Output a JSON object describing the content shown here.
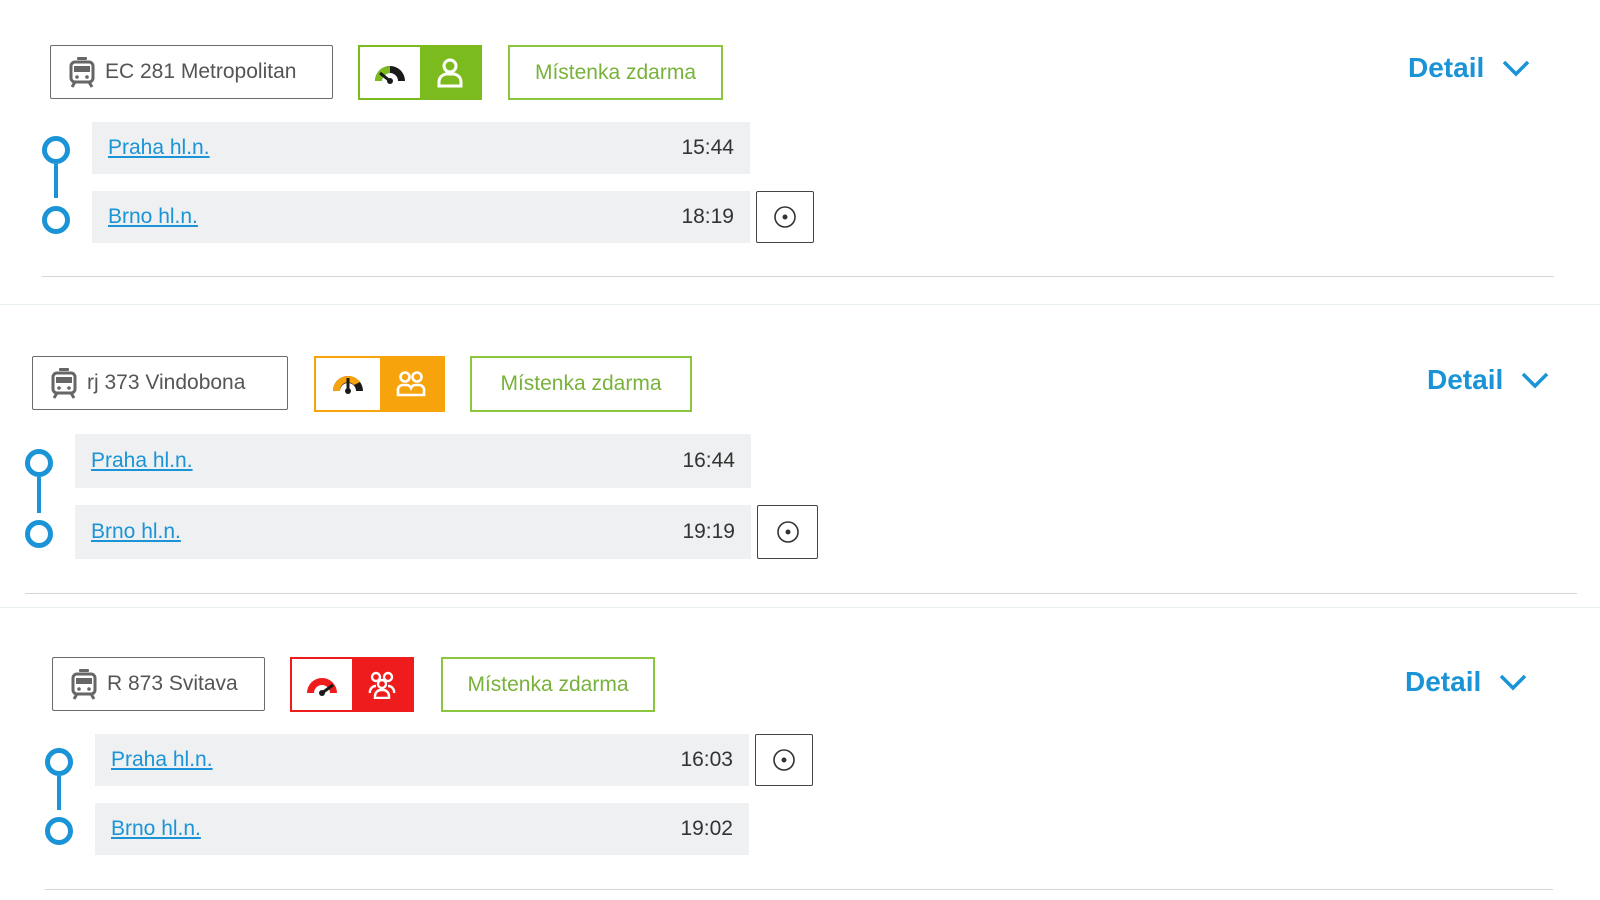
{
  "connections": [
    {
      "train": "EC 281 Metropolitan",
      "occupancy": "low",
      "occupancy_color": "#7cbb1e",
      "seat_label": "Místenka zdarma",
      "detail_label": "Detail",
      "stops": [
        {
          "name": "Praha hl.n.",
          "time": "15:44"
        },
        {
          "name": "Brno hl.n.",
          "time": "18:19"
        }
      ]
    },
    {
      "train": "rj 373 Vindobona",
      "occupancy": "medium",
      "occupancy_color": "#f7a30b",
      "seat_label": "Místenka zdarma",
      "detail_label": "Detail",
      "stops": [
        {
          "name": "Praha hl.n.",
          "time": "16:44"
        },
        {
          "name": "Brno hl.n.",
          "time": "19:19"
        }
      ]
    },
    {
      "train": "R 873 Svitava",
      "occupancy": "high",
      "occupancy_color": "#ee1c1c",
      "seat_label": "Místenka zdarma",
      "detail_label": "Detail",
      "stops": [
        {
          "name": "Praha hl.n.",
          "time": "16:03"
        },
        {
          "name": "Brno hl.n.",
          "time": "19:02"
        }
      ]
    }
  ],
  "icons": {
    "train": "train-icon",
    "gauge": "gauge-icon",
    "person": "person-icon",
    "chevron": "chevron-down-icon",
    "map_pin": "location-target-icon"
  }
}
